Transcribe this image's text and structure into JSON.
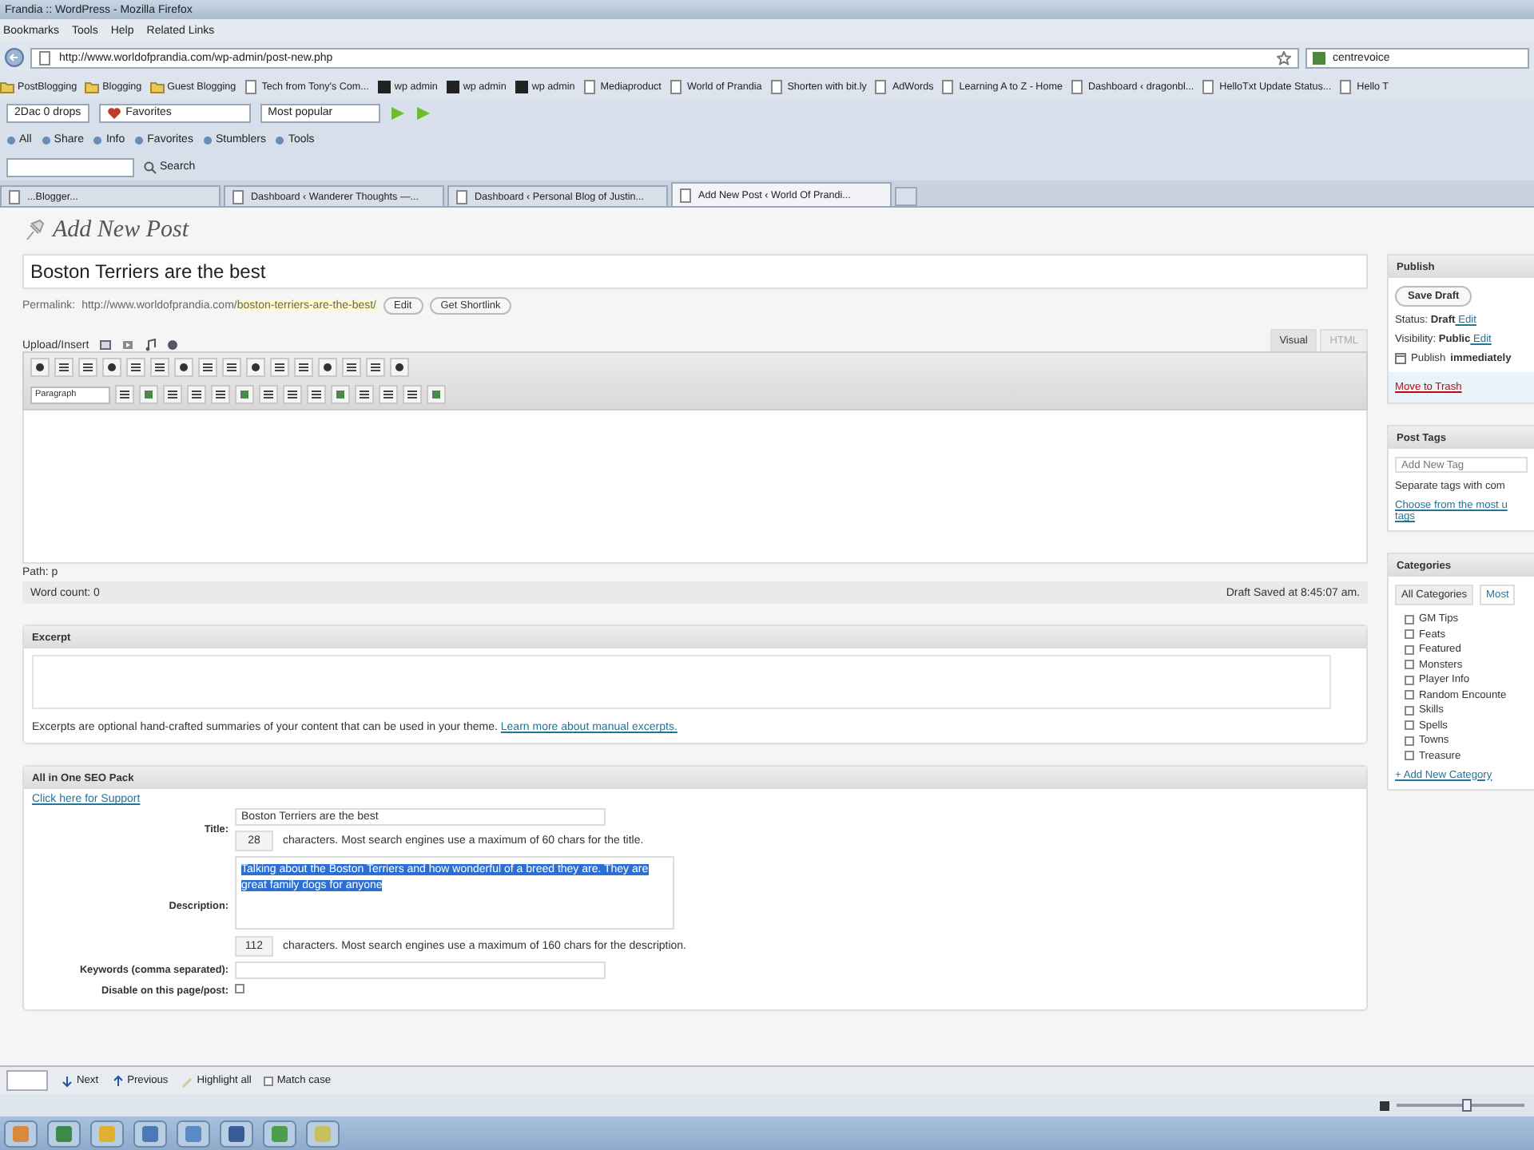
{
  "window": {
    "title": "Frandia :: WordPress - Mozilla Firefox"
  },
  "menu": [
    "Bookmarks",
    "Tools",
    "Help",
    "Related Links"
  ],
  "address_bar": {
    "url": "http://www.worldofprandia.com/wp-admin/post-new.php",
    "search": "centrevoice"
  },
  "bookmarks": [
    "PostBlogging",
    "Blogging",
    "Guest Blogging",
    "Tech from Tony's Com...",
    "wp admin",
    "wp admin",
    "wp admin",
    "Mediaproduct",
    "World of Prandia",
    "Shorten with bit.ly",
    "AdWords",
    "Learning A to Z - Home",
    "Dashboard ‹ dragonbl...",
    "HelloTxt Update Status...",
    "Hello T"
  ],
  "toolbar_1": {
    "drops": "2Dac 0 drops",
    "favorites": "Favorites",
    "sort": "Most popular"
  },
  "toolbar_2": [
    "All",
    "Share",
    "Info",
    "Favorites",
    "Stumblers",
    "Tools"
  ],
  "toolbar_3": {
    "search": "Search"
  },
  "tabs": [
    {
      "label": "...Blogger...",
      "selected": false
    },
    {
      "label": "Dashboard ‹ Wanderer Thoughts —...",
      "selected": false
    },
    {
      "label": "Dashboard ‹ Personal Blog of Justin...",
      "selected": false
    },
    {
      "label": "Add New Post ‹ World Of Prandi...",
      "selected": true
    }
  ],
  "post": {
    "heading": "Add New Post",
    "title_value": "Boston Terriers are the best",
    "permalink_label": "Permalink:",
    "permalink_base": "http://www.worldofprandia.com/",
    "permalink_slug": "boston-terriers-are-the-best/",
    "permalink_buttons": [
      "Edit",
      "Get Shortlink"
    ],
    "upload_label": "Upload/Insert",
    "editor_tabs": [
      {
        "label": "Visual",
        "selected": true
      },
      {
        "label": "HTML",
        "selected": false
      }
    ],
    "paragraph_format": "Paragraph",
    "path": "Path: p",
    "word_count": "Word count: 0",
    "draft_saved": "Draft Saved at 8:45:07 am."
  },
  "excerpt": {
    "title": "Excerpt",
    "help": "Excerpts are optional hand-crafted summaries of your content that can be used in your theme.",
    "link": "Learn more about manual excerpts."
  },
  "seo": {
    "title": "All in One SEO Pack",
    "support_link": "Click here for Support",
    "title_label": "Title:",
    "title_value": "Boston Terriers are the best",
    "title_count": "28",
    "title_hint": "characters. Most search engines use a maximum of 60 chars for the title.",
    "description_label": "Description:",
    "description_value": "Talking about the Boston Terriers and how wonderful of a breed they are.  They are great family dogs for anyone",
    "description_count": "112",
    "description_hint": "characters. Most search engines use a maximum of 160 chars for the description.",
    "keywords_label": "Keywords (comma separated):",
    "disable_label": "Disable on this page/post:",
    "disable_checked": false
  },
  "publish": {
    "title": "Publish",
    "save_draft": "Save Draft",
    "status_label": "Status:",
    "status": "Draft",
    "status_edit": "Edit",
    "visibility_label": "Visibility:",
    "visibility": "Public",
    "visibility_edit": "Edit",
    "publish_label": "Publish",
    "publish_when": "immediately",
    "trash": "Move to Trash"
  },
  "post_tags": {
    "title": "Post Tags",
    "placeholder": "Add New Tag",
    "hint": "Separate tags with com",
    "choose_link": "Choose from the most u",
    "choose_link_2": "tags"
  },
  "categories": {
    "title": "Categories",
    "tabs": [
      {
        "label": "All Categories",
        "selected": true
      },
      {
        "label": "Most",
        "selected": false
      }
    ],
    "items": [
      {
        "label": "GM Tips",
        "checked": false
      },
      {
        "label": "Feats",
        "checked": false
      },
      {
        "label": "Featured",
        "checked": false
      },
      {
        "label": "Monsters",
        "checked": false
      },
      {
        "label": "Player Info",
        "checked": false
      },
      {
        "label": "Random Encounte",
        "checked": false
      },
      {
        "label": "Skills",
        "checked": false
      },
      {
        "label": "Spells",
        "checked": false
      },
      {
        "label": "Towns",
        "checked": false
      },
      {
        "label": "Treasure",
        "checked": false
      }
    ],
    "add_link": "+ Add New Category"
  },
  "find_bar": {
    "next": "Next",
    "previous": "Previous",
    "highlight": "Highlight all",
    "match_case": "Match case",
    "match_case_checked": false
  },
  "zoom_slider": {
    "level": 0.55
  }
}
